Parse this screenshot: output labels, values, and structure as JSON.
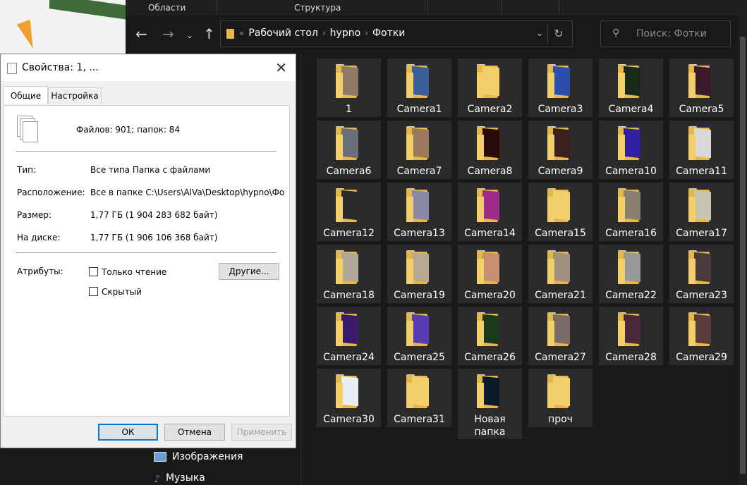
{
  "ribbon": {
    "areas_label": "Области",
    "structure_label": "Структура"
  },
  "address": {
    "crumbs": [
      "Рабочий стол",
      "hypno",
      "Фотки"
    ],
    "overflow": "«"
  },
  "search": {
    "placeholder": "Поиск: Фотки"
  },
  "nav_pane": {
    "items": [
      {
        "label": "Изображения"
      },
      {
        "label": "Музыка"
      }
    ]
  },
  "folders": [
    {
      "name": "1",
      "photo": "#8c7a66"
    },
    {
      "name": "Camera1",
      "photo": "#3b5e9a"
    },
    {
      "name": "Camera2",
      "photo": "#f2cf6a"
    },
    {
      "name": "Camera3",
      "photo": "#2a4fb0"
    },
    {
      "name": "Camera4",
      "photo": "#1a2a1a"
    },
    {
      "name": "Camera5",
      "photo": "#3a1a2a"
    },
    {
      "name": "Camera6",
      "photo": "#6a6f7a"
    },
    {
      "name": "Camera7",
      "photo": "#9a7a5a"
    },
    {
      "name": "Camera8",
      "photo": "#2a0a0a"
    },
    {
      "name": "Camera9",
      "photo": "#3a2020"
    },
    {
      "name": "Camera10",
      "photo": "#3020a0"
    },
    {
      "name": "Camera11",
      "photo": "#d8d8d8"
    },
    {
      "name": "Camera12",
      "photo": "#2a2a2a"
    },
    {
      "name": "Camera13",
      "photo": "#8a8aa8"
    },
    {
      "name": "Camera14",
      "photo": "#a02a8a"
    },
    {
      "name": "Camera15",
      "photo": "#f2cf6a"
    },
    {
      "name": "Camera16",
      "photo": "#8a8070"
    },
    {
      "name": "Camera17",
      "photo": "#c8c4b0"
    },
    {
      "name": "Camera18",
      "photo": "#b0a898"
    },
    {
      "name": "Camera19",
      "photo": "#b8a890"
    },
    {
      "name": "Camera20",
      "photo": "#c89070"
    },
    {
      "name": "Camera21",
      "photo": "#a09080"
    },
    {
      "name": "Camera22",
      "photo": "#989898"
    },
    {
      "name": "Camera23",
      "photo": "#4a3a3a"
    },
    {
      "name": "Camera24",
      "photo": "#3a1a6a"
    },
    {
      "name": "Camera25",
      "photo": "#5a3ab0"
    },
    {
      "name": "Camera26",
      "photo": "#1a3a1a"
    },
    {
      "name": "Camera27",
      "photo": "#7a6a6a"
    },
    {
      "name": "Camera28",
      "photo": "#4a2a3a"
    },
    {
      "name": "Camera29",
      "photo": "#5a3a3a"
    },
    {
      "name": "Camera30",
      "photo": "#e8eef4"
    },
    {
      "name": "Camera31",
      "photo": "#f2cf6a"
    },
    {
      "name": "Новая папка",
      "photo": "#0a1a2a"
    },
    {
      "name": "проч",
      "photo": "#f2cf6a"
    }
  ],
  "dialog": {
    "title": "Свойства: 1, ...",
    "tabs": [
      "Общие",
      "Настройка"
    ],
    "summary": "Файлов: 901; папок: 84",
    "type_label": "Тип:",
    "type_value": "Все типа Папка с файлами",
    "location_label": "Расположение:",
    "location_value": "Все в папке C:\\Users\\AlVa\\Desktop\\hypno\\Фот",
    "size_label": "Размер:",
    "size_value": "1,77 ГБ (1 904 283 682 байт)",
    "disk_label": "На диске:",
    "disk_value": "1,77 ГБ (1 906 106 368 байт)",
    "attributes_label": "Атрибуты:",
    "readonly_label": "Только чтение",
    "hidden_label": "Скрытый",
    "other_button": "Другие...",
    "ok_button": "ОК",
    "cancel_button": "Отмена",
    "apply_button": "Применить"
  }
}
